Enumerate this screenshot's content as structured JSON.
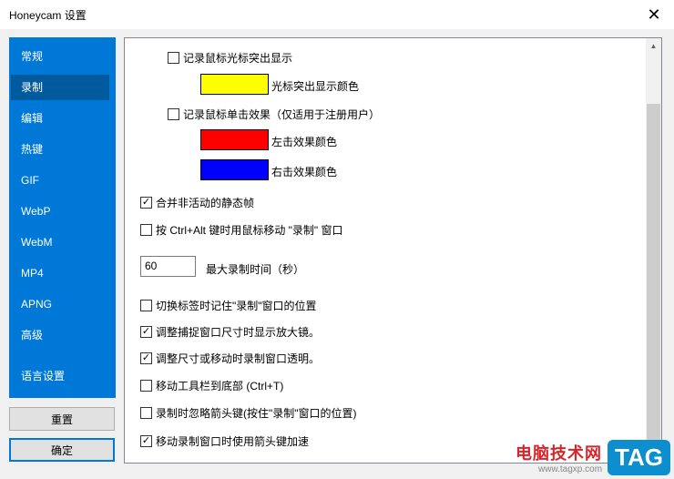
{
  "window": {
    "title": "Honeycam 设置",
    "close_glyph": "✕"
  },
  "sidebar": {
    "items": [
      {
        "label": "常规"
      },
      {
        "label": "录制"
      },
      {
        "label": "编辑"
      },
      {
        "label": "热键"
      },
      {
        "label": "GIF"
      },
      {
        "label": "WebP"
      },
      {
        "label": "WebM"
      },
      {
        "label": "MP4"
      },
      {
        "label": "APNG"
      },
      {
        "label": "高级"
      },
      {
        "label": "语言设置"
      }
    ],
    "active_index": 1
  },
  "buttons": {
    "reset": "重置",
    "ok": "确定"
  },
  "settings": {
    "highlight_cursor": {
      "label": "记录鼠标光标突出显示",
      "checked": false
    },
    "highlight_color": {
      "label": "光标突出显示颜色",
      "color": "#ffff00"
    },
    "click_effect": {
      "label": "记录鼠标单击效果（仅适用于注册用户）",
      "checked": false
    },
    "left_click_color": {
      "label": "左击效果颜色",
      "color": "#ff0000"
    },
    "right_click_color": {
      "label": "右击效果颜色",
      "color": "#0000ff"
    },
    "merge_static": {
      "label": "合并非活动的静态帧",
      "checked": true
    },
    "ctrl_alt_move": {
      "label": "按 Ctrl+Alt 键时用鼠标移动 \"录制\" 窗口",
      "checked": false
    },
    "max_record_time": {
      "value": "60",
      "label": "最大录制时间（秒）"
    },
    "remember_position": {
      "label": "切换标签时记住\"录制\"窗口的位置",
      "checked": false
    },
    "magnifier": {
      "label": "调整捕捉窗口尺寸时显示放大镜。",
      "checked": true
    },
    "transparent": {
      "label": "调整尺寸或移动时录制窗口透明。",
      "checked": true
    },
    "toolbar_bottom": {
      "label": "移动工具栏到底部 (Ctrl+T)",
      "checked": false
    },
    "ignore_arrows": {
      "label": "录制时忽略箭头键(按住\"录制\"窗口的位置)",
      "checked": false
    },
    "arrow_accel": {
      "label": "移动录制窗口时使用箭头键加速",
      "checked": true
    }
  },
  "watermark": {
    "name": "电脑技术网",
    "url": "www.tagxp.com",
    "tag": "TAG"
  }
}
